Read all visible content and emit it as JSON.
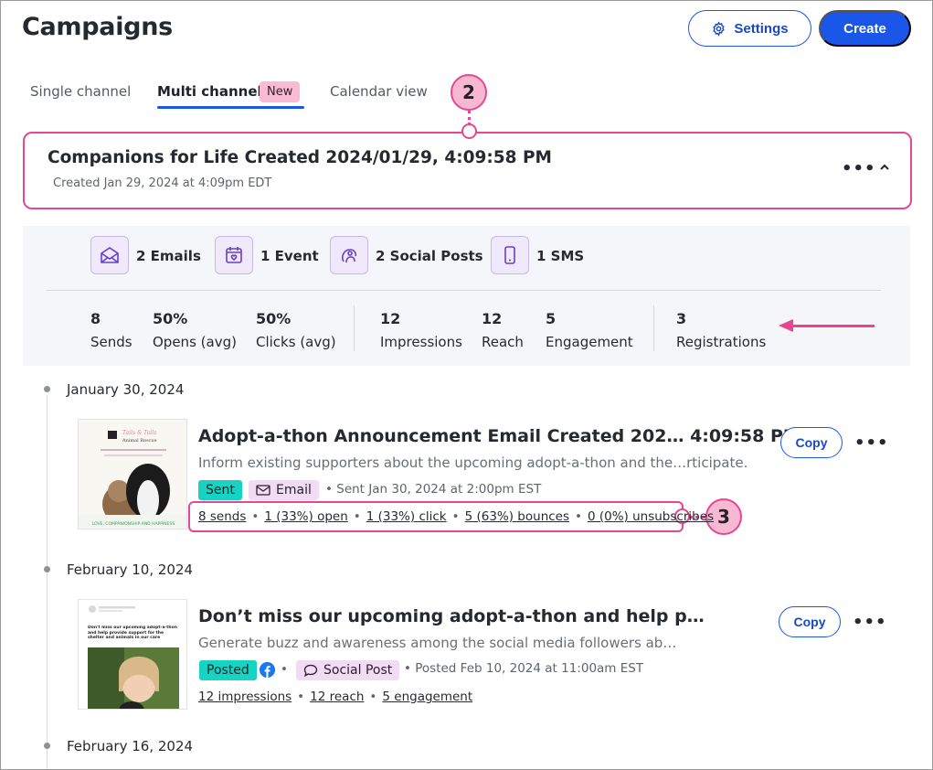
{
  "header": {
    "title": "Campaigns",
    "settings_label": "Settings",
    "create_label": "Create"
  },
  "tabs": {
    "single": "Single channel",
    "multi": "Multi channel",
    "new_badge": "New",
    "calendar": "Calendar view"
  },
  "callouts": {
    "header": "2",
    "stats": "3"
  },
  "campaign": {
    "title": "Companions for Life Created 2024/01/29, 4:09:58 PM",
    "created": "Created Jan 29, 2024 at 4:09pm EDT"
  },
  "channels": [
    {
      "icon": "email-icon",
      "label": "2 Emails"
    },
    {
      "icon": "event-icon",
      "label": "1 Event"
    },
    {
      "icon": "social-post-icon",
      "label": "2 Social Posts"
    },
    {
      "icon": "sms-icon",
      "label": "1 SMS"
    }
  ],
  "stats": [
    {
      "value": "8",
      "label": "Sends"
    },
    {
      "value": "50%",
      "label": "Opens (avg)"
    },
    {
      "value": "50%",
      "label": "Clicks (avg)"
    },
    {
      "value": "12",
      "label": "Impressions"
    },
    {
      "value": "12",
      "label": "Reach"
    },
    {
      "value": "5",
      "label": "Engagement"
    },
    {
      "value": "3",
      "label": "Registrations"
    }
  ],
  "timeline": [
    {
      "date": "January 30, 2024",
      "title": "Adopt-a-thon Announcement Email Created 202… 4:09:58 PM",
      "description": "Inform existing supporters about the upcoming adopt-a-thon and the…rticipate.",
      "status": "Sent",
      "type": "Email",
      "meta": "• Sent Jan 30, 2024 at 2:00pm EST",
      "links": [
        "8 sends",
        "1 (33%) open",
        "1 (33%) click",
        "5 (63%) bounces",
        "0 (0%) unsubscribes"
      ],
      "copy_label": "Copy"
    },
    {
      "date": "February 10, 2024",
      "title": "Don’t miss our upcoming adopt-a-thon and help p…",
      "description": "Generate buzz and awareness among the social media followers ab…",
      "status": "Posted",
      "type": "Social Post",
      "meta": "• Posted Feb 10, 2024 at 11:00am EST",
      "links": [
        "12 impressions",
        "12 reach",
        "5 engagement"
      ],
      "copy_label": "Copy"
    },
    {
      "date": "February 16, 2024"
    }
  ],
  "thumbnail_email": {
    "brand": "Tails & Tails",
    "brand_sub": "Animal Rescue",
    "footer": "LOVE, COMPANIONSHIP AND HAPPINESS"
  },
  "thumbnail_social": {
    "text": "Don't miss our upcoming adopt-a-thon and help provide support for the shelter and animals in our care"
  },
  "colors": {
    "accent": "#1a56e8",
    "highlight": "#e8478f",
    "sent": "#16d3c3",
    "type_badge": "#f2dcf3",
    "new_badge": "#f7bcd4"
  }
}
